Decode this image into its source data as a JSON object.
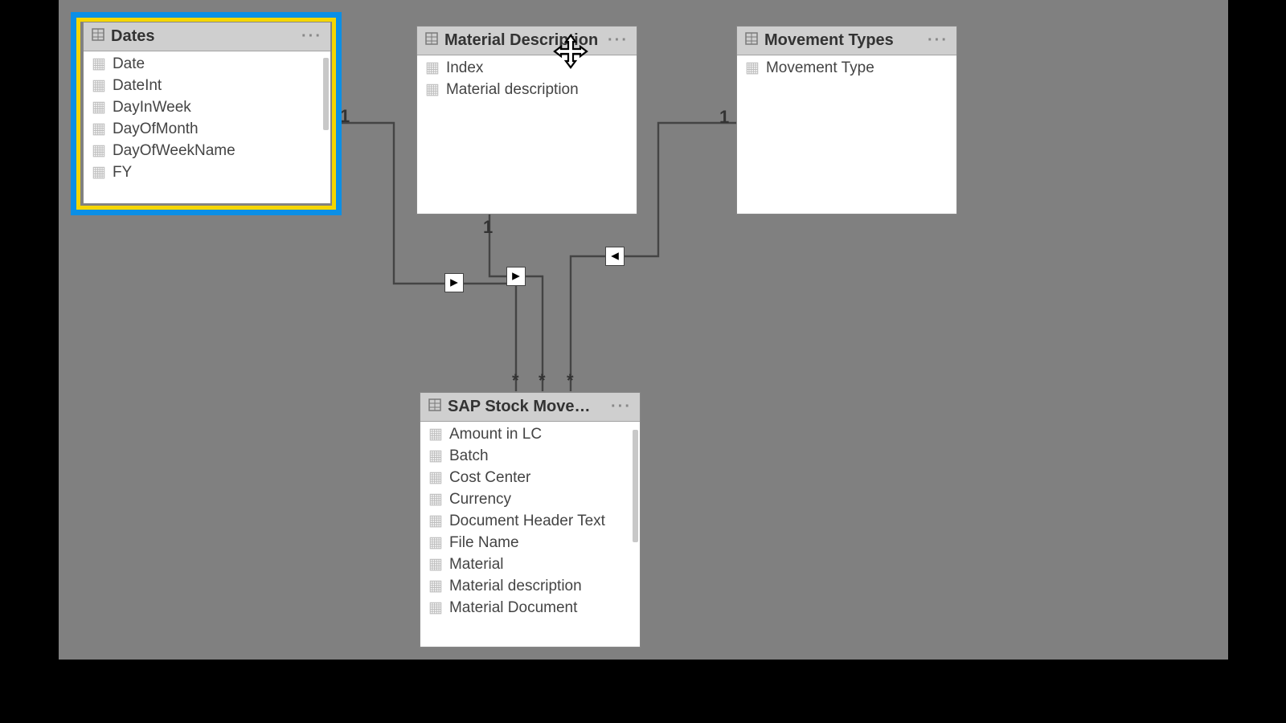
{
  "tables": {
    "dates": {
      "title": "Dates",
      "fields": [
        "Date",
        "DateInt",
        "DayInWeek",
        "DayOfMonth",
        "DayOfWeekName",
        "FY"
      ]
    },
    "material": {
      "title": "Material Description",
      "fields": [
        "Index",
        "Material description"
      ]
    },
    "movement": {
      "title": "Movement Types",
      "fields": [
        "Movement Type"
      ]
    },
    "stock": {
      "title": "SAP Stock Movements",
      "fields": [
        "Amount in LC",
        "Batch",
        "Cost Center",
        "Currency",
        "Document Header Text",
        "File Name",
        "Material",
        "Material description",
        "Material Document"
      ]
    }
  },
  "relations": {
    "dates_to_stock": {
      "from_card": "1",
      "to_card": "*",
      "direction": "right"
    },
    "material_to_stock": {
      "from_card": "1",
      "to_card": "*",
      "direction": "right"
    },
    "movement_to_stock": {
      "from_card": "1",
      "to_card": "*",
      "direction": "left"
    }
  }
}
